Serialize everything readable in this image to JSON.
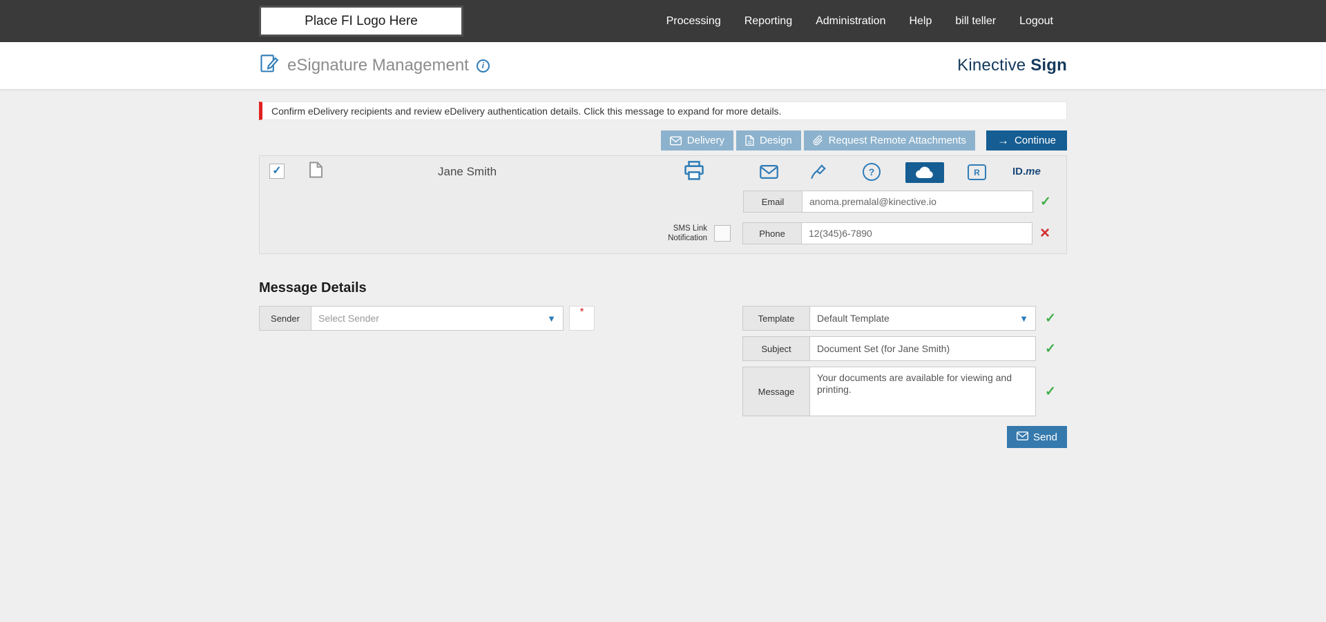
{
  "topbar": {
    "logo_text": "Place FI Logo Here",
    "nav": [
      "Processing",
      "Reporting",
      "Administration",
      "Help",
      "bill teller",
      "Logout"
    ]
  },
  "header": {
    "title": "eSignature Management",
    "brand_name": "Kinective",
    "brand_product": "Sign"
  },
  "alert": {
    "text": "Confirm eDelivery recipients and review eDelivery authentication details. Click this message to expand for more details."
  },
  "toolbar": {
    "delivery": "Delivery",
    "design": "Design",
    "request_remote_attachments": "Request Remote Attachments",
    "continue": "Continue"
  },
  "recipient": {
    "name": "Jane Smith",
    "email": {
      "label": "Email",
      "value": "anoma.premalal@kinective.io"
    },
    "sms": {
      "line1": "SMS Link",
      "line2": "Notification"
    },
    "phone": {
      "label": "Phone",
      "value": "12(345)6-7890"
    },
    "idme": {
      "id": "ID.",
      "me": "me"
    }
  },
  "message_details": {
    "heading": "Message Details",
    "sender": {
      "label": "Sender",
      "placeholder": "Select Sender"
    },
    "template": {
      "label": "Template",
      "value": "Default Template"
    },
    "subject": {
      "label": "Subject",
      "value": "Document Set (for Jane Smith)"
    },
    "message": {
      "label": "Message",
      "value": "Your documents are available for viewing and printing."
    },
    "send": "Send"
  },
  "icons": {
    "check": "✓",
    "cross": "×",
    "question": "?",
    "remote_r": "R",
    "info": "i",
    "arrow": "→",
    "dropdown": "▼",
    "required": "*"
  },
  "colors": {
    "accent_blue": "#2e7cb8",
    "dark_blue": "#155d93",
    "brand_navy": "#14395c",
    "success_green": "#3fae49",
    "error_red": "#d32f2f",
    "alert_red": "#e02020",
    "light_button_blue": "#8cb2cd",
    "send_blue": "#3579ad"
  }
}
